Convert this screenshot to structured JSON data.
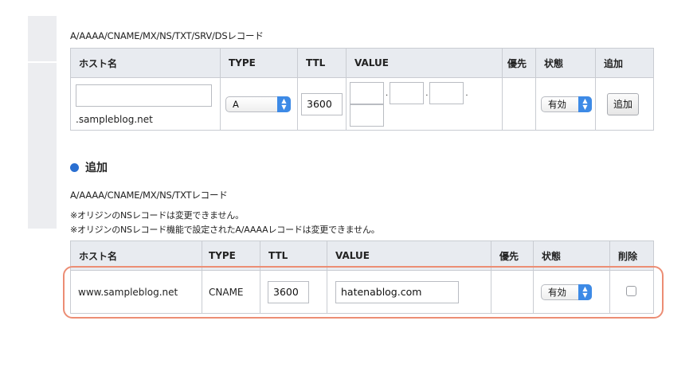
{
  "top": {
    "caption": "A/AAAA/CNAME/MX/NS/TXT/SRV/DSレコード",
    "headers": {
      "host": "ホスト名",
      "type": "TYPE",
      "ttl": "TTL",
      "value": "VALUE",
      "priority": "優先",
      "state": "状態",
      "add": "追加"
    },
    "row": {
      "host_value": "",
      "domain_suffix": ".sampleblog.net",
      "type_selected": "A",
      "ttl_value": "3600",
      "ip_octet_separator": ".",
      "state_selected": "有効",
      "add_button": "追加"
    }
  },
  "section": {
    "title": "追加",
    "caption": "A/AAAA/CNAME/MX/NS/TXTレコード",
    "note1": "※オリジンのNSレコードは変更できません。",
    "note2": "※オリジンのNSレコード機能で設定されたA/AAAAレコードは変更できません。"
  },
  "bottom": {
    "headers": {
      "host": "ホスト名",
      "type": "TYPE",
      "ttl": "TTL",
      "value": "VALUE",
      "priority": "優先",
      "state": "状態",
      "delete": "削除"
    },
    "row": {
      "host": "www.sampleblog.net",
      "type": "CNAME",
      "ttl_value": "3600",
      "value": "hatenablog.com",
      "state_selected": "有効",
      "delete_checked": false
    }
  },
  "colors": {
    "header_bg": "#e8ebf0",
    "accent_blue": "#3d8ae6",
    "highlight": "#ec8d74"
  }
}
